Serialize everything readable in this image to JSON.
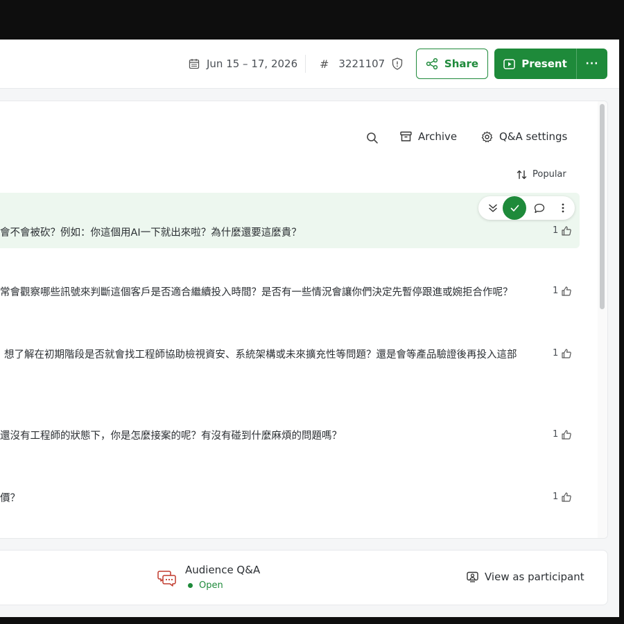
{
  "header": {
    "date_range": "Jun 15 – 17, 2026",
    "event_code_symbol": "#",
    "event_code": "3221107",
    "share_label": "Share",
    "present_label": "Present",
    "more_label": "···"
  },
  "toolbar": {
    "archive_label": "Archive",
    "settings_label": "Q&A settings",
    "sort_label": "Popular"
  },
  "questions": [
    {
      "text": "會不會被砍？例如：你這個用AI一下就出來啦？為什麼還要這麼貴？",
      "votes": "1",
      "highlighted": true
    },
    {
      "text": "常會觀察哪些訊號來判斷這個客戶是否適合繼續投入時間？是否有一些情況會讓你們決定先暫停跟進或婉拒合作呢？",
      "votes": "1"
    },
    {
      "text": "想了解在初期階段是否就會找工程師協助檢視資安、系統架構或未來擴充性等問題？還是會等產品驗證後再投入這部",
      "votes": "1"
    },
    {
      "text": "還沒有工程師的狀態下，你是怎麼接案的呢？有沒有碰到什麼麻煩的問題嗎？",
      "votes": "1"
    },
    {
      "text": "價？",
      "votes": "1"
    }
  ],
  "footer": {
    "qa_title": "Audience Q&A",
    "qa_status": "Open",
    "view_participant_label": "View as participant"
  },
  "colors": {
    "brand_green": "#1e8a3a",
    "highlight_bg": "#edf7ef",
    "qa_icon_red": "#c0392b"
  }
}
